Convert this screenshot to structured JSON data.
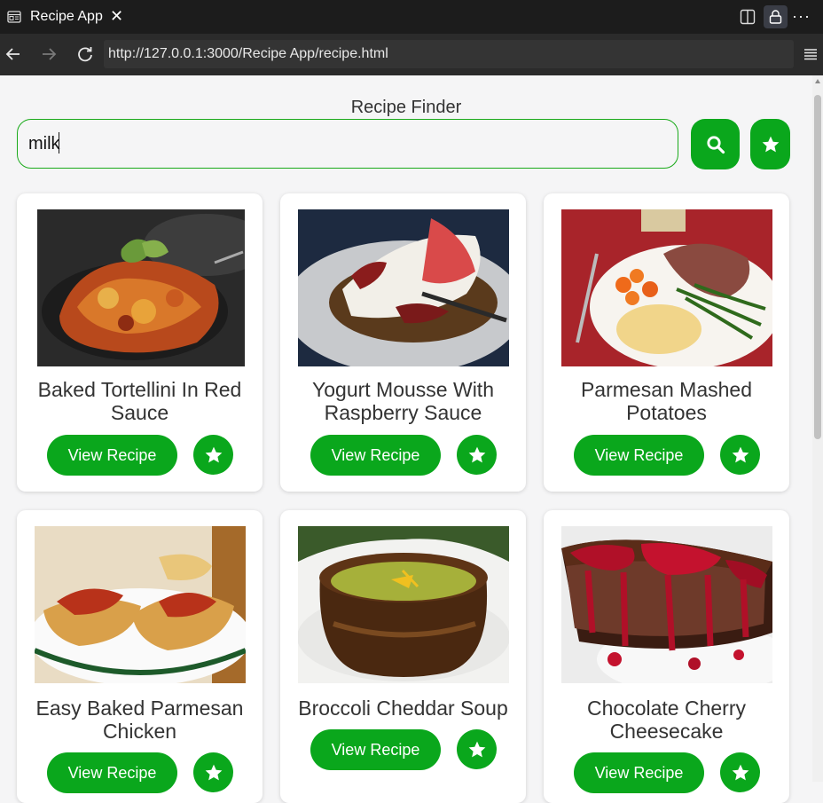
{
  "browser": {
    "tab_title": "Recipe App",
    "tab_close": "✕",
    "url": "http://127.0.0.1:3000/Recipe App/recipe.html",
    "more": "···"
  },
  "page": {
    "heading": "Recipe Finder",
    "search_value": "milk",
    "accent_color": "#0aa71c"
  },
  "recipes": [
    {
      "title": "Baked Tortellini In Red Sauce",
      "button": "View Recipe",
      "image": "baked-tortellini-photo"
    },
    {
      "title": "Yogurt Mousse With Raspberry Sauce",
      "button": "View Recipe",
      "image": "yogurt-mousse-photo"
    },
    {
      "title": "Parmesan Mashed Potatoes",
      "button": "View Recipe",
      "image": "mashed-potatoes-photo"
    },
    {
      "title": "Easy Baked Parmesan Chicken",
      "button": "View Recipe",
      "image": "parmesan-chicken-photo"
    },
    {
      "title": "Broccoli Cheddar Soup",
      "button": "View Recipe",
      "image": "broccoli-soup-photo"
    },
    {
      "title": "Chocolate Cherry Cheesecake",
      "button": "View Recipe",
      "image": "cherry-cheesecake-photo"
    }
  ]
}
